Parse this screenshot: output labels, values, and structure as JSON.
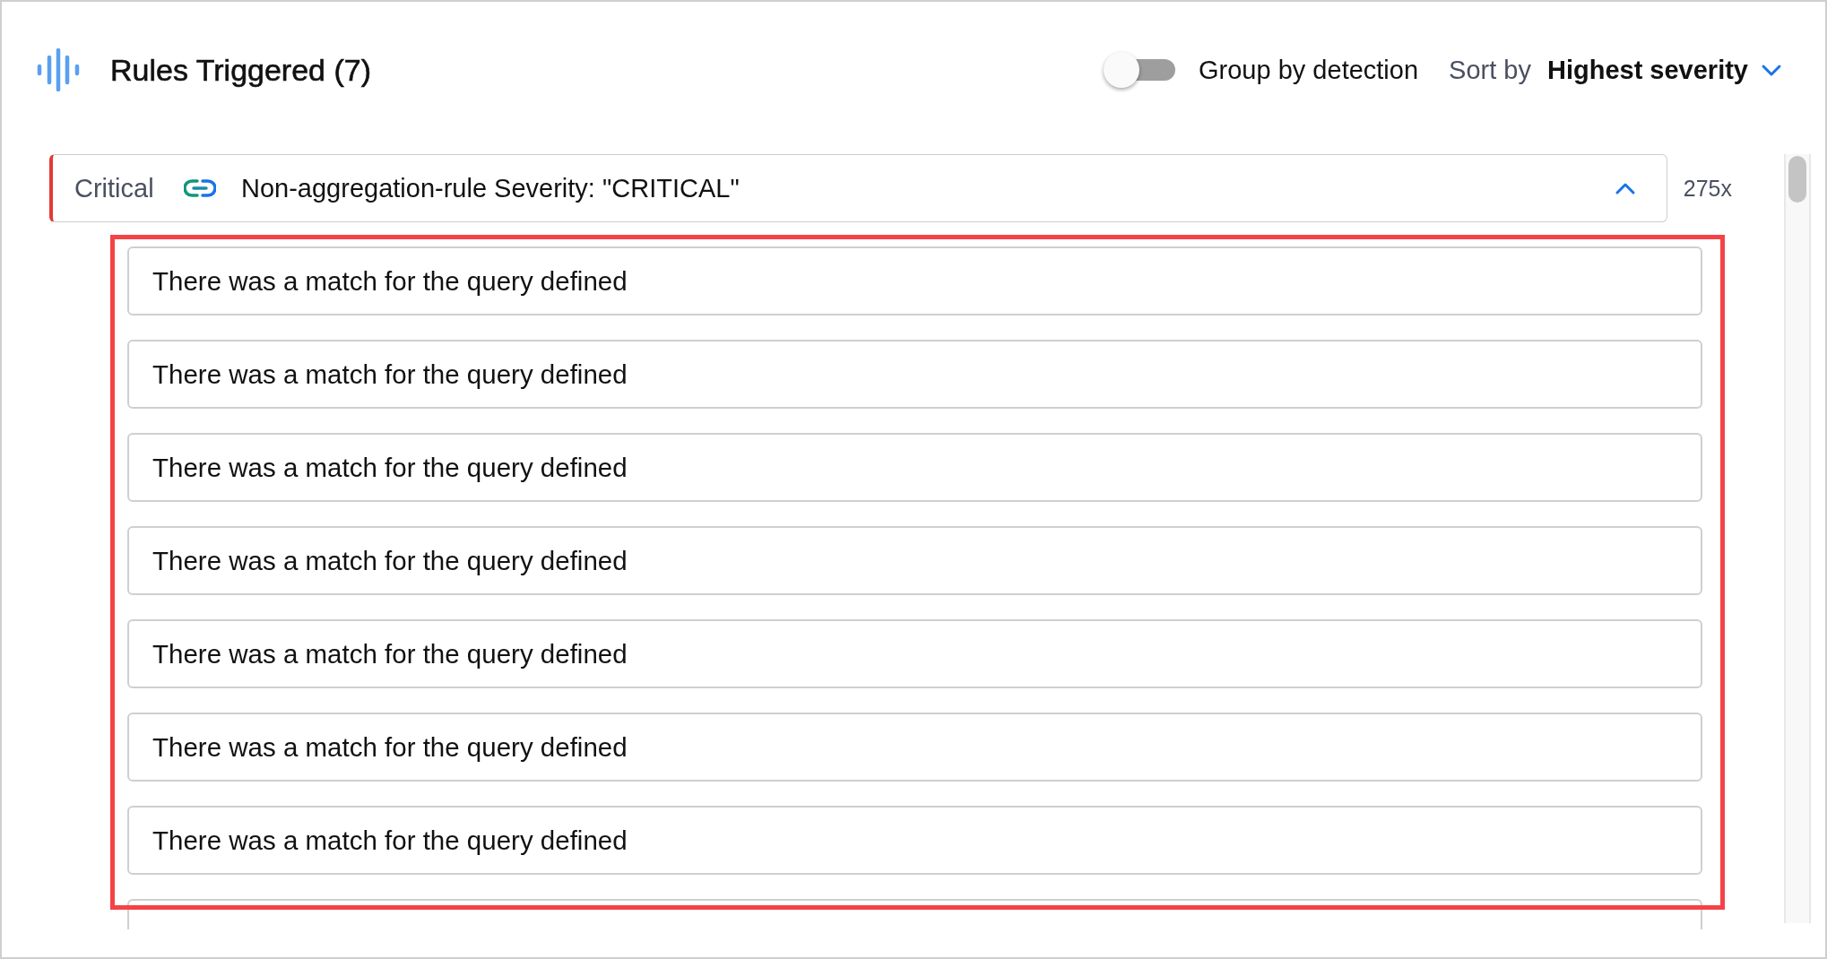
{
  "header": {
    "title": "Rules Triggered (7)",
    "group_by": {
      "label": "Group by detection",
      "on": false
    },
    "sort": {
      "label": "Sort by",
      "value": "Highest severity"
    }
  },
  "rule": {
    "severity": "Critical",
    "title": "Non-aggregation-rule Severity: \"CRITICAL\"",
    "expanded": true,
    "count": "275x"
  },
  "matches": [
    "There was a match for the query defined",
    "There was a match for the query defined",
    "There was a match for the query defined",
    "There was a match for the query defined",
    "There was a match for the query defined",
    "There was a match for the query defined",
    "There was a match for the query defined"
  ]
}
